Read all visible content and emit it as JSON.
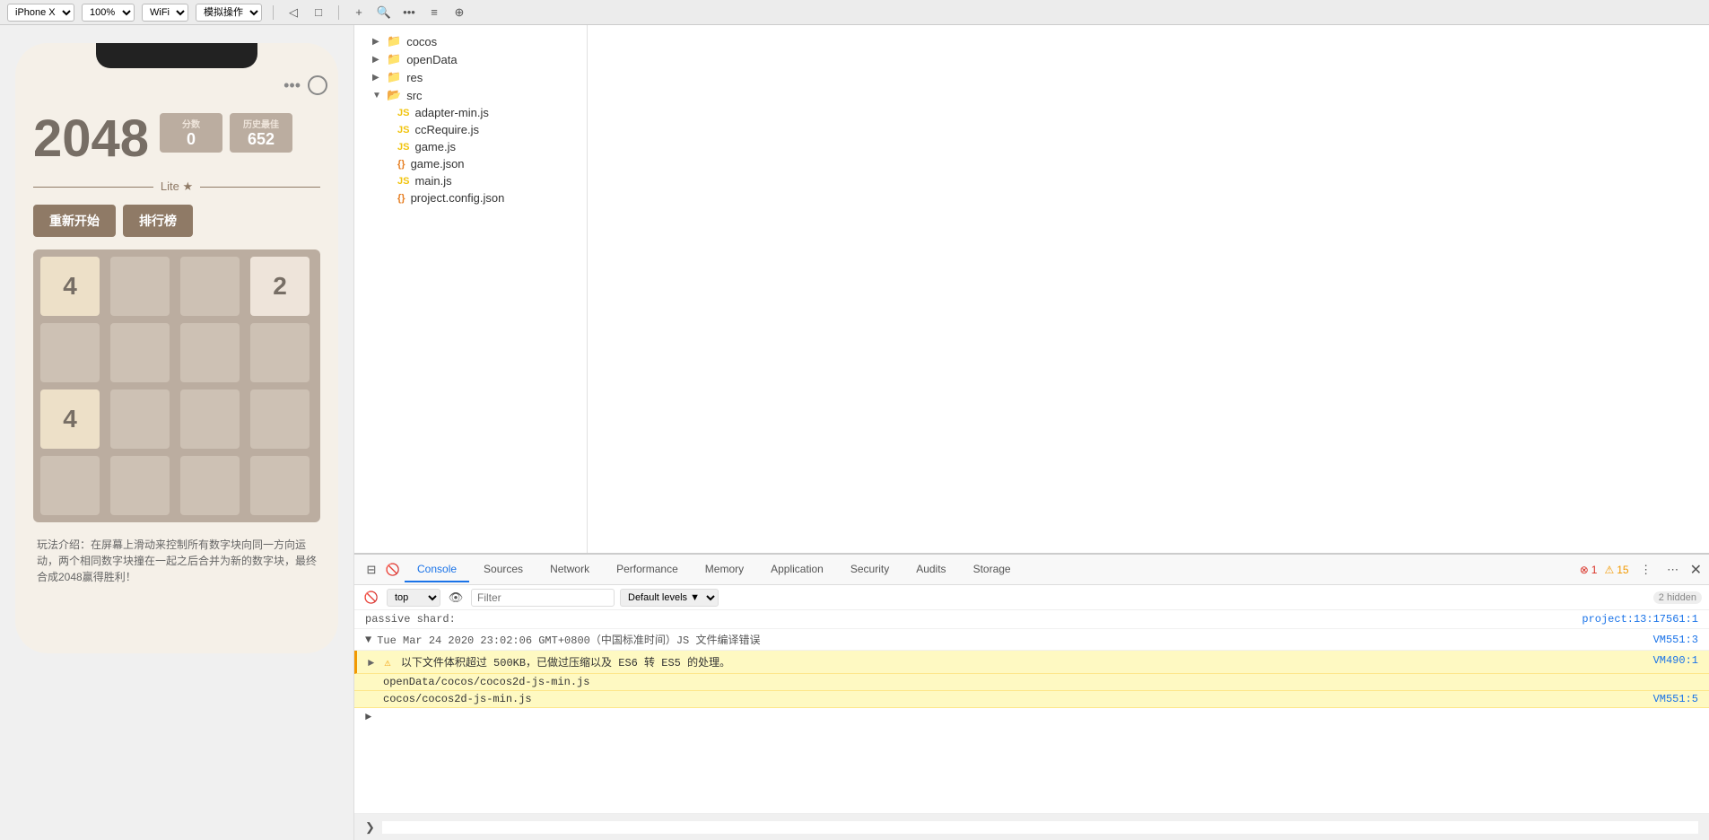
{
  "toolbar": {
    "device": "iPhone X",
    "zoom": "100%",
    "network": "WiFi",
    "mode": "模拟操作",
    "icons": [
      "◁",
      "□",
      "+",
      "🔍",
      "•••",
      "≡",
      "⊕"
    ]
  },
  "simulator": {
    "game_title": "2048",
    "score_label": "分数",
    "score_value": "0",
    "best_label": "历史最佳",
    "best_value": "652",
    "lite_text": "Lite ★",
    "btn_restart": "重新开始",
    "btn_rank": "排行榜",
    "grid": [
      {
        "value": "4",
        "tile": "4"
      },
      {
        "value": "",
        "tile": ""
      },
      {
        "value": "",
        "tile": ""
      },
      {
        "value": "2",
        "tile": "2"
      },
      {
        "value": "",
        "tile": ""
      },
      {
        "value": "",
        "tile": ""
      },
      {
        "value": "",
        "tile": ""
      },
      {
        "value": "",
        "tile": ""
      },
      {
        "value": "4",
        "tile": "4"
      },
      {
        "value": "",
        "tile": ""
      },
      {
        "value": "",
        "tile": ""
      },
      {
        "value": "",
        "tile": ""
      },
      {
        "value": "",
        "tile": ""
      },
      {
        "value": "",
        "tile": ""
      },
      {
        "value": "",
        "tile": ""
      },
      {
        "value": "",
        "tile": ""
      }
    ],
    "description": "玩法介绍：在屏幕上滑动来控制所有数字块向同一方向运动，两个相同数字块撞在一起之后合并为新的数字块，最终合成2048赢得胜利！"
  },
  "file_tree": {
    "items": [
      {
        "label": "cocos",
        "type": "folder",
        "indent": 1,
        "expanded": true,
        "arrow": "▶"
      },
      {
        "label": "openData",
        "type": "folder",
        "indent": 1,
        "expanded": false,
        "arrow": "▶"
      },
      {
        "label": "res",
        "type": "folder",
        "indent": 1,
        "expanded": false,
        "arrow": "▶"
      },
      {
        "label": "src",
        "type": "folder",
        "indent": 1,
        "expanded": true,
        "arrow": "▼"
      },
      {
        "label": "adapter-min.js",
        "type": "js",
        "indent": 2,
        "expanded": false,
        "arrow": ""
      },
      {
        "label": "ccRequire.js",
        "type": "js",
        "indent": 2,
        "expanded": false,
        "arrow": ""
      },
      {
        "label": "game.js",
        "type": "js",
        "indent": 2,
        "expanded": false,
        "arrow": ""
      },
      {
        "label": "game.json",
        "type": "json",
        "indent": 2,
        "expanded": false,
        "arrow": ""
      },
      {
        "label": "main.js",
        "type": "js",
        "indent": 2,
        "expanded": false,
        "arrow": ""
      },
      {
        "label": "project.config.json",
        "type": "json",
        "indent": 2,
        "expanded": false,
        "arrow": ""
      }
    ]
  },
  "devtools": {
    "tabs": [
      {
        "label": "Console",
        "active": true
      },
      {
        "label": "Sources",
        "active": false
      },
      {
        "label": "Network",
        "active": false
      },
      {
        "label": "Performance",
        "active": false
      },
      {
        "label": "Memory",
        "active": false
      },
      {
        "label": "Application",
        "active": false
      },
      {
        "label": "Security",
        "active": false
      },
      {
        "label": "Audits",
        "active": false
      },
      {
        "label": "Storage",
        "active": false
      }
    ],
    "error_count": "1",
    "warn_count": "15",
    "hidden_count": "2 hidden",
    "context": "top",
    "filter_placeholder": "Filter",
    "level_label": "Default levels",
    "console_rows": [
      {
        "type": "passive",
        "text": "passive shard:"
      },
      {
        "type": "timestamp",
        "text": "Tue Mar 24 2020 23:02:06 GMT+0800（中国标准时间）JS 文件编译错误"
      },
      {
        "type": "warn",
        "warn_text": "►以下文件体积超过 500KB，已做过压缩以及 ES6 转 ES5 的处理。",
        "link": "VM490:1"
      },
      {
        "type": "file",
        "text": "openData/cocos/cocos2d-js-min.js"
      },
      {
        "type": "file",
        "text": "cocos/cocos2d-js-min.js",
        "link": "VM551:5"
      }
    ],
    "links": {
      "passive": "project:13:17561:1",
      "timestamp": "VM551:3",
      "warn": "VM490:1",
      "file1": "VM551:3",
      "file2": "VM551:5"
    }
  }
}
